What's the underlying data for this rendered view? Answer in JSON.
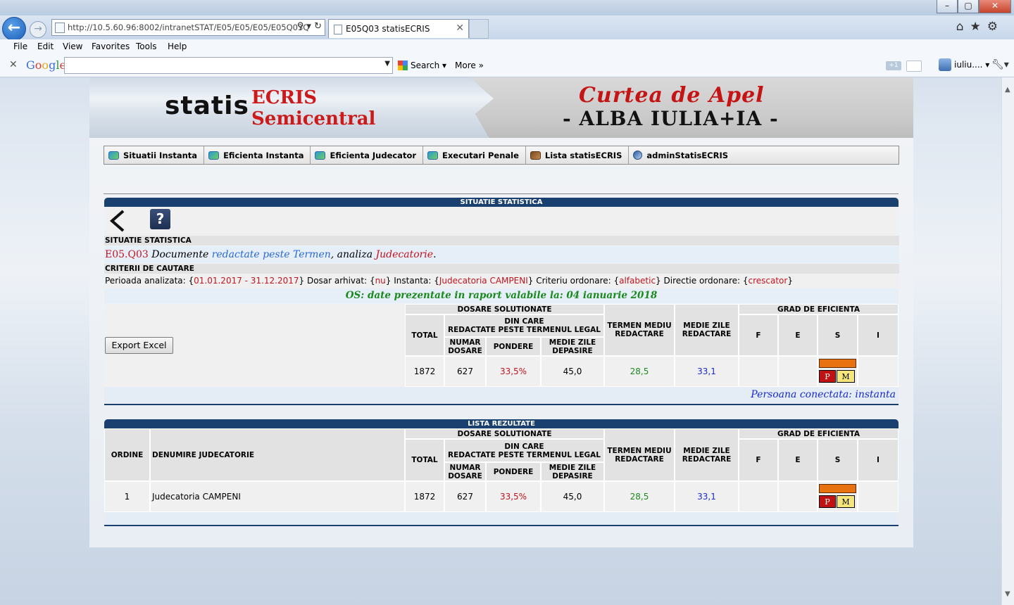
{
  "browser": {
    "url": "http://10.5.60.96:8002/intranetSTAT/E05/E05/E05/E05Q03Q",
    "url_host": "10.5.60.96",
    "tab_title": "E05Q03 statisECRIS",
    "menus": [
      "File",
      "Edit",
      "View",
      "Favorites",
      "Tools",
      "Help"
    ],
    "google_logo": "Google",
    "google_search_label": "Search",
    "google_more_label": "More",
    "google_user": "iuliu....",
    "google_plus": "+1"
  },
  "banner": {
    "logo_statis": "statis",
    "logo_ecris": "ECRIS",
    "logo_semicentral": "Semicentral",
    "court_line1": "Curtea de Apel",
    "court_line2": "- ALBA IULIA+IA -"
  },
  "nav": [
    {
      "label": "Situatii Instanta",
      "icon": "stat-icon"
    },
    {
      "label": "Eficienta Instanta",
      "icon": "stat-icon"
    },
    {
      "label": "Eficienta Judecator",
      "icon": "stat-icon"
    },
    {
      "label": "Executari Penale",
      "icon": "stat-icon"
    },
    {
      "label": "Lista statisECRIS",
      "icon": "gavel-icon"
    },
    {
      "label": "adminStatisECRIS",
      "icon": "admin-icon"
    }
  ],
  "situatie": {
    "panel_title": "SITUATIE STATISTICA",
    "section_title": "SITUATIE STATISTICA",
    "report_code": "E05.Q03",
    "report_doc": "Documente",
    "report_highlight": "redactate peste Termen",
    "report_mid": ", analiza",
    "report_scope": "Judecatorie",
    "report_end": ".",
    "criteria_title": "CRITERII DE CAUTARE",
    "criteria": {
      "period_label": "Perioada analizata:",
      "period_value": "01.01.2017 - 31.12.2017",
      "archived_label": "Dosar arhivat:",
      "archived_value": "nu",
      "court_label": "Instanta:",
      "court_value": "Judecatoria CAMPENI",
      "order_label": "Criteriu ordonare:",
      "order_value": "alfabetic",
      "direction_label": "Directie ordonare:",
      "direction_value": "crescator"
    },
    "os_note": "OS: date prezentate in raport valabile la: 04 ianuarie 2018",
    "export_label": "Export Excel",
    "connected_user": "Persoana conectata: instanta"
  },
  "headers": {
    "dosare_solutionate": "DOSARE SOLUTIONATE",
    "din_care": "DIN CARE",
    "redactate_peste": "REDACTATE PESTE TERMENUL LEGAL",
    "total": "TOTAL",
    "numar": "NUMAR",
    "dosare": "DOSARE",
    "pondere": "PONDERE",
    "medie_zile": "MEDIE ZILE",
    "depasire": "DEPASIRE",
    "termen_mediu": "TERMEN MEDIU",
    "redactare": "REDACTARE",
    "medie_zile2": "MEDIE ZILE",
    "redactare2": "REDACTARE",
    "grad_eficienta": "GRAD DE EFICIENTA",
    "f": "F",
    "e": "E",
    "s": "S",
    "i": "I",
    "ordine": "ORDINE",
    "denumire": "DENUMIRE JUDECATORIE"
  },
  "summary": {
    "total": "1872",
    "numar_dosare": "627",
    "pondere": "33,5%",
    "medie_zile_depasire": "45,0",
    "termen_mediu": "28,5",
    "medie_zile_redactare": "33,1",
    "indicator_p": "P",
    "indicator_m": "M"
  },
  "lista": {
    "panel_title": "LISTA REZULTATE",
    "rows": [
      {
        "ordine": "1",
        "denumire": "Judecatoria CAMPENI",
        "total": "1872",
        "numar_dosare": "627",
        "pondere": "33,5%",
        "medie_zile_depasire": "45,0",
        "termen_mediu": "28,5",
        "medie_zile_redactare": "33,1",
        "indicator_p": "P",
        "indicator_m": "M"
      }
    ]
  },
  "colors": {
    "panel_header": "#1a4070",
    "red_value": "#c0141e",
    "green_value": "#1a8a1e",
    "blue_value": "#1a2acc",
    "indicator_bar": "#e8720f"
  }
}
